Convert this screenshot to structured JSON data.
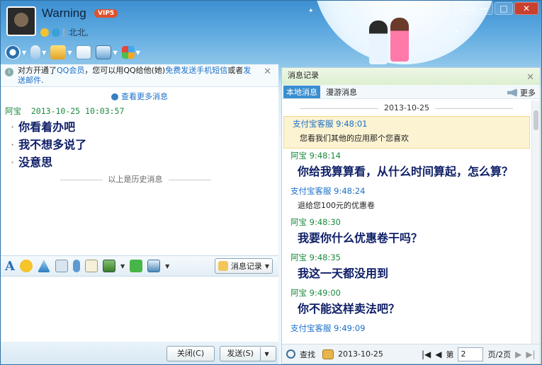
{
  "window": {
    "title": "Warning",
    "vip_label": "VIP5",
    "location": "北北,",
    "controls": [
      "▭",
      "—",
      "□",
      "✕"
    ]
  },
  "toolbar": {
    "icons": [
      "video-call-icon",
      "voice-call-icon",
      "file-transfer-icon",
      "sms-icon",
      "remote-desktop-icon",
      "apps-icon"
    ]
  },
  "notice": {
    "text_a": "对方开通了",
    "link_a": "QQ会员",
    "text_b": "，您可以用QQ给他(她)",
    "link_b": "免费发送手机短信",
    "text_c": "或者",
    "link_c": "发送邮件",
    "text_d": "."
  },
  "chat": {
    "more_messages": "查看更多消息",
    "sender": "阿宝",
    "timestamp": "2013-10-25 10:03:57",
    "messages": [
      "你看着办吧",
      "我不想多说了",
      "没意思"
    ],
    "history_separator": "以上是历史消息"
  },
  "input_toolbar": {
    "history_button": "消息记录"
  },
  "actions": {
    "close": "关闭(C)",
    "send": "发送(S)"
  },
  "history": {
    "title": "消息记录",
    "tabs": [
      "本地消息",
      "漫游消息"
    ],
    "more": "更多",
    "date": "2013-10-25",
    "messages": [
      {
        "sender": "支付宝客服 9:48:01",
        "text": "您看我们其他的应用那个您喜欢"
      },
      {
        "sender": "阿宝 9:48:14",
        "text": "你给我算算看，从什么时间算起，怎么算？"
      },
      {
        "sender": "支付宝客服 9:48:24",
        "text": "退给您100元的优惠卷"
      },
      {
        "sender": "阿宝 9:48:30",
        "text": "我要你什么优惠卷干吗？"
      },
      {
        "sender": "阿宝 9:48:35",
        "text": "我这一天都没用到"
      },
      {
        "sender": "阿宝 9:49:00",
        "text": "你不能这样卖法吧？"
      },
      {
        "sender": "支付宝客服 9:49:09",
        "text": ""
      }
    ],
    "footer": {
      "search": "查找",
      "date": "2013-10-25",
      "page_label": "第",
      "page_value": "2",
      "page_total": "页/2页"
    }
  }
}
